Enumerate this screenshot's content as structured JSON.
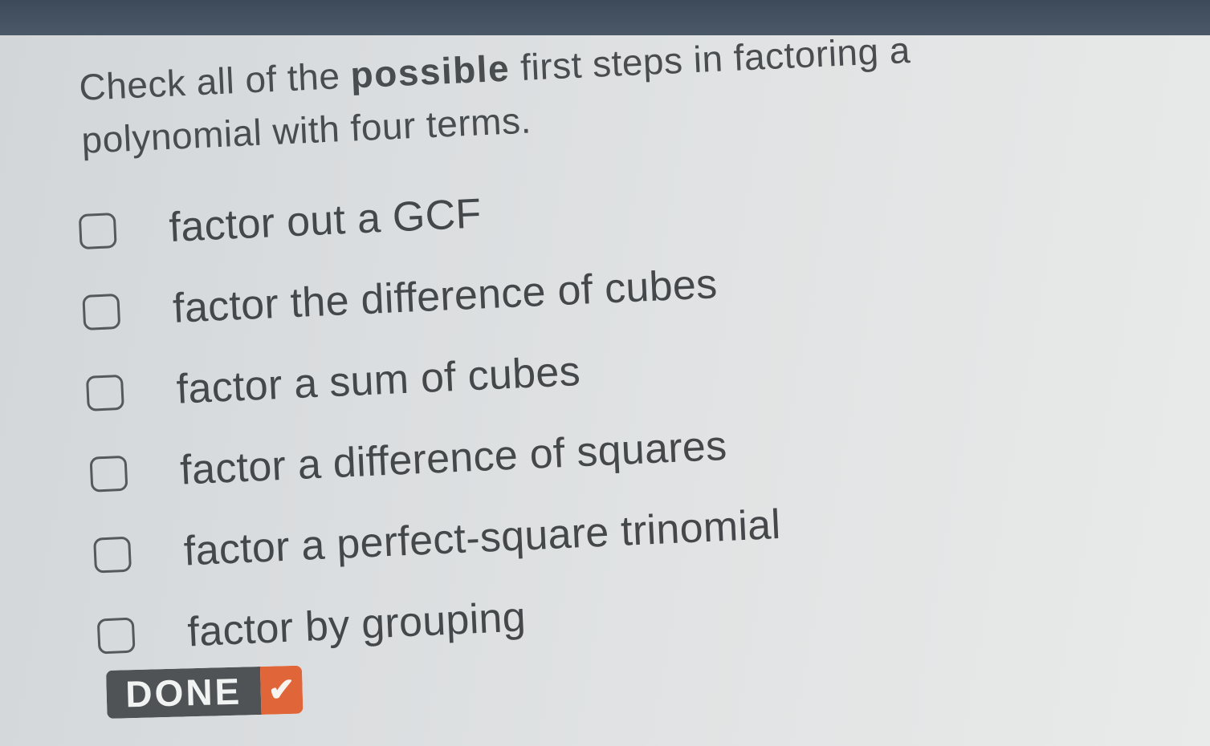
{
  "question": {
    "prompt_before": "Check all of the ",
    "prompt_emphasis": "possible",
    "prompt_after": " first steps in factoring a polynomial with four terms."
  },
  "options": [
    {
      "label": "factor out a GCF",
      "checked": false
    },
    {
      "label": "factor the difference of cubes",
      "checked": false
    },
    {
      "label": "factor a sum of cubes",
      "checked": false
    },
    {
      "label": "factor a difference of squares",
      "checked": false
    },
    {
      "label": "factor a perfect-square trinomial",
      "checked": false
    },
    {
      "label": "factor by grouping",
      "checked": false
    }
  ],
  "done_button": {
    "label": "DONE",
    "icon": "checkmark-icon",
    "colors": {
      "label_bg": "#4f5356",
      "check_bg": "#e0663a"
    }
  }
}
